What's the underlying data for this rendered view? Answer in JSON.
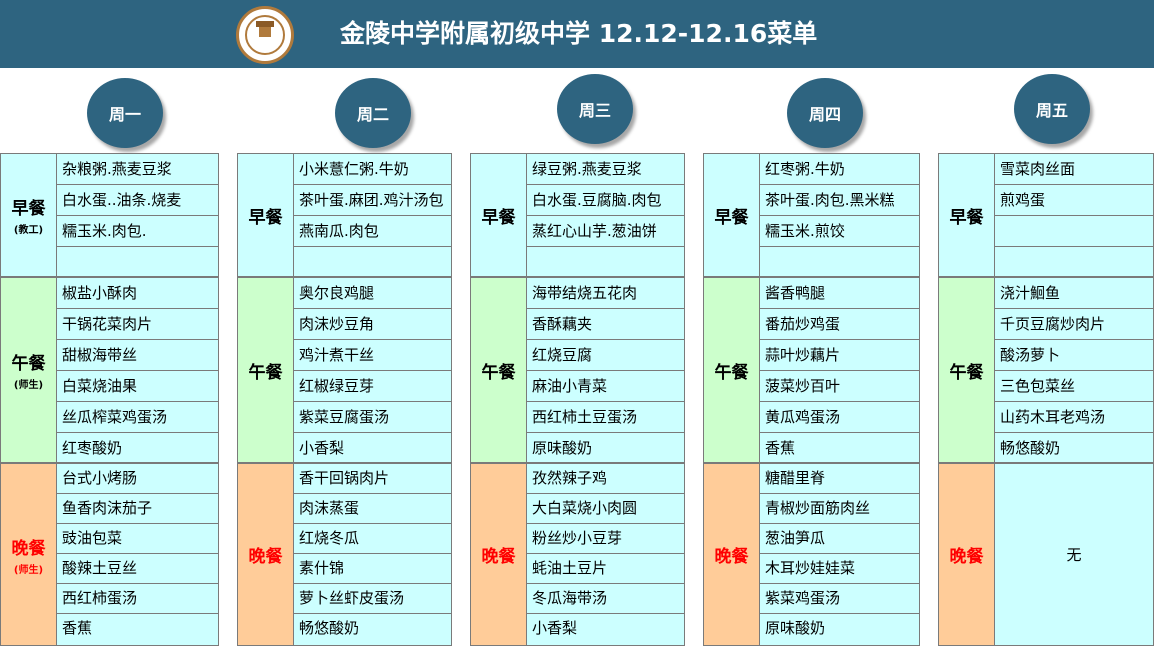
{
  "title": "金陵中学附属初级中学 12.12-12.16菜单",
  "logo": {
    "icon": "school-emblem-icon"
  },
  "days": [
    "周一",
    "周二",
    "周三",
    "周四",
    "周五"
  ],
  "meals": {
    "breakfast": {
      "label": "早餐",
      "note": "(教工)"
    },
    "lunch": {
      "label": "午餐",
      "note": "(师生)"
    },
    "dinner": {
      "label": "晚餐",
      "note": "(师生)"
    }
  },
  "menu": [
    {
      "breakfast": [
        "杂粮粥.燕麦豆浆",
        "白水蛋..油条.烧麦",
        "糯玉米.肉包.",
        ""
      ],
      "lunch": [
        "椒盐小酥肉",
        "干锅花菜肉片",
        "甜椒海带丝",
        "白菜烧油果",
        "丝瓜榨菜鸡蛋汤",
        "红枣酸奶"
      ],
      "dinner": [
        "台式小烤肠",
        "鱼香肉沫茄子",
        "豉油包菜",
        "酸辣土豆丝",
        "西红柿蛋汤",
        "香蕉"
      ]
    },
    {
      "breakfast": [
        "小米薏仁粥.牛奶",
        "茶叶蛋.麻团.鸡汁汤包",
        "燕南瓜.肉包",
        ""
      ],
      "lunch": [
        "奥尔良鸡腿",
        "肉沫炒豆角",
        "鸡汁煮干丝",
        "红椒绿豆芽",
        "紫菜豆腐蛋汤",
        "小香梨"
      ],
      "dinner": [
        "香干回锅肉片",
        "肉沫蒸蛋",
        "红烧冬瓜",
        "素什锦",
        "萝卜丝虾皮蛋汤",
        "畅悠酸奶"
      ]
    },
    {
      "breakfast": [
        "绿豆粥.燕麦豆浆",
        "白水蛋.豆腐脑.肉包",
        "蒸红心山芋.葱油饼",
        ""
      ],
      "lunch": [
        "海带结烧五花肉",
        "香酥藕夹",
        "红烧豆腐",
        "麻油小青菜",
        "西红柿土豆蛋汤",
        "原味酸奶"
      ],
      "dinner": [
        "孜然辣子鸡",
        "大白菜烧小肉圆",
        "粉丝炒小豆芽",
        "蚝油土豆片",
        "冬瓜海带汤",
        "小香梨"
      ]
    },
    {
      "breakfast": [
        "红枣粥.牛奶",
        "茶叶蛋.肉包.黑米糕",
        "糯玉米.煎饺",
        ""
      ],
      "lunch": [
        "酱香鸭腿",
        "番茄炒鸡蛋",
        "蒜叶炒藕片",
        "菠菜炒百叶",
        "黄瓜鸡蛋汤",
        "香蕉"
      ],
      "dinner": [
        "糖醋里脊",
        "青椒炒面筋肉丝",
        "葱油笋瓜",
        "木耳炒娃娃菜",
        "紫菜鸡蛋汤",
        "原味酸奶"
      ]
    },
    {
      "breakfast": [
        "雪菜肉丝面",
        "煎鸡蛋",
        "",
        ""
      ],
      "lunch": [
        "浇汁鮰鱼",
        "千页豆腐炒肉片",
        "酸汤萝卜",
        "三色包菜丝",
        "山药木耳老鸡汤",
        "畅悠酸奶"
      ],
      "dinner_none": "无"
    }
  ]
}
